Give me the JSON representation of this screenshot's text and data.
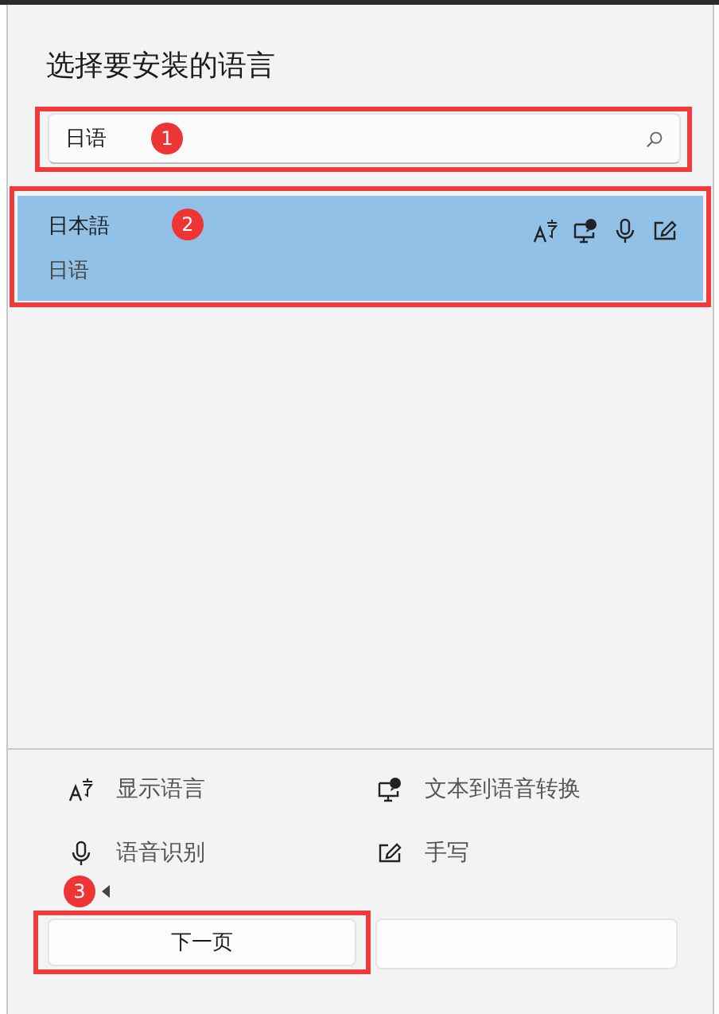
{
  "dialog": {
    "title": "选择要安装的语言",
    "search": {
      "value": "日语"
    },
    "results": [
      {
        "name": "日本語",
        "subtitle": "日语",
        "selected": true,
        "features": [
          {
            "kind": "display"
          },
          {
            "kind": "tts"
          },
          {
            "kind": "speech"
          },
          {
            "kind": "handwriting"
          }
        ]
      }
    ],
    "legend": [
      {
        "kind": "display",
        "label": "显示语言"
      },
      {
        "kind": "tts",
        "label": "文本到语音转换"
      },
      {
        "kind": "speech",
        "label": "语音识别"
      },
      {
        "kind": "handwriting",
        "label": "手写"
      }
    ],
    "buttons": [
      {
        "label": "下一页"
      }
    ]
  },
  "annotations": [
    {
      "number": "1"
    },
    {
      "number": "2"
    },
    {
      "number": "3"
    }
  ]
}
